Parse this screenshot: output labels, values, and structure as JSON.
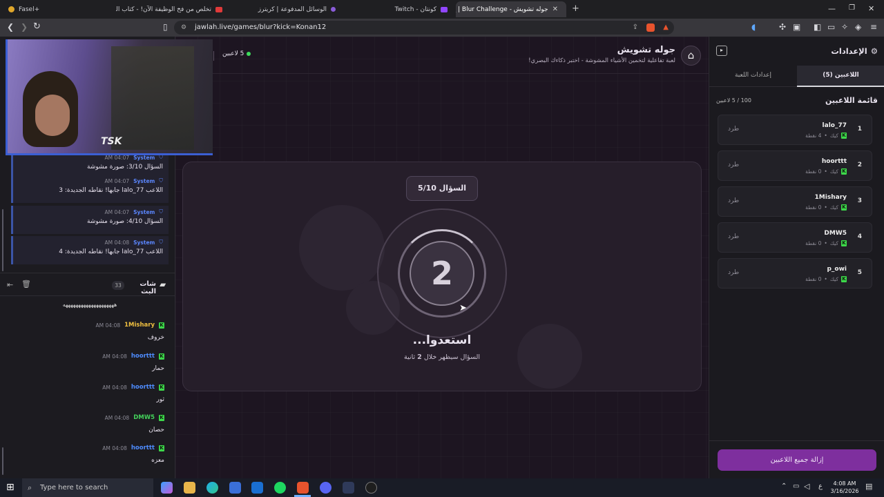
{
  "browser": {
    "tabs": [
      {
        "title": "Fasel+",
        "color": "#e0a72b"
      },
      {
        "title": "تخلص من فخ الوظيفة الآن! - كتاب الثد...",
        "color": "#e03a3a"
      },
      {
        "title": "الوسائل المدفوعة | كريترز",
        "color": "#8a5cd8"
      },
      {
        "title": "كونتان - Twitch",
        "color": "#9146ff"
      },
      {
        "title": "جوله تشويش - Blur Challenge | ج...",
        "color": "#8f3bb0"
      }
    ],
    "new_tab": "+",
    "url": "jawlah.live/games/blur?kick=Konan12"
  },
  "stream_overlay": {
    "logo": "TSK"
  },
  "system_messages": [
    {
      "sender": "System",
      "time": "04:07 AM",
      "text": "السؤال 3/10: صورة مشوشة"
    },
    {
      "sender": "System",
      "time": "04:07 AM",
      "text": "اللاعب lalo_77 جابها! نقاطه الجديدة: 3"
    },
    {
      "sender": "System",
      "time": "04:07 AM",
      "text": "السؤال 4/10: صورة مشوشة"
    },
    {
      "sender": "System",
      "time": "04:08 AM",
      "text": "اللاعب lalo_77 جابها! نقاطه الجديدة: 4"
    }
  ],
  "chat": {
    "title": "شات البث",
    "count": "33",
    "spam": "ههههههههههههههههههههه",
    "messages": [
      {
        "user": "1Mishary",
        "color": "#f0c040",
        "time": "04:08 AM",
        "text": "خروف"
      },
      {
        "user": "hoorttt",
        "color": "#4e8cff",
        "time": "04:08 AM",
        "text": "حمار"
      },
      {
        "user": "hoorttt",
        "color": "#4e8cff",
        "time": "04:08 AM",
        "text": "ثور"
      },
      {
        "user": "DMW5",
        "color": "#43d15a",
        "time": "04:08 AM",
        "text": "حصان"
      },
      {
        "user": "hoorttt",
        "color": "#4e8cff",
        "time": "04:08 AM",
        "text": "معزه"
      }
    ]
  },
  "game": {
    "title": "جوله تشويش",
    "subtitle": "لعبة تفاعلية لتخمين الأشياء المشوشة - اختبر ذكاءك البصري!",
    "players_online": "5 لاعبين",
    "question_badge": "السؤال 5/10",
    "countdown": "2",
    "ready_text": "استعدوا...",
    "next_pre": "السؤال سيظهر خلال",
    "next_num": "2",
    "next_post": "ثانية"
  },
  "settings": {
    "title": "الإعدادات",
    "tab_players": "اللاعبين (5)",
    "tab_game": "إعدادات اللعبة",
    "list_title": "قائمة اللاعبين",
    "capacity": "100 / 5 لاعبين",
    "kick_label": "طرد",
    "platform": "كيك",
    "players": [
      {
        "rank": "1",
        "name": "lalo_77",
        "points": "4 نقطة"
      },
      {
        "rank": "2",
        "name": "hoorttt",
        "points": "0 نقطة"
      },
      {
        "rank": "3",
        "name": "1Mishary",
        "points": "0 نقطة"
      },
      {
        "rank": "4",
        "name": "DMW5",
        "points": "0 نقطة"
      },
      {
        "rank": "5",
        "name": "p_owi",
        "points": "0 نقطة"
      }
    ],
    "remove_all": "إزالة جميع اللاعبين"
  },
  "taskbar": {
    "search_placeholder": "Type here to search",
    "time": "4:08 AM",
    "date": "3/16/2026",
    "lang": "ع"
  }
}
